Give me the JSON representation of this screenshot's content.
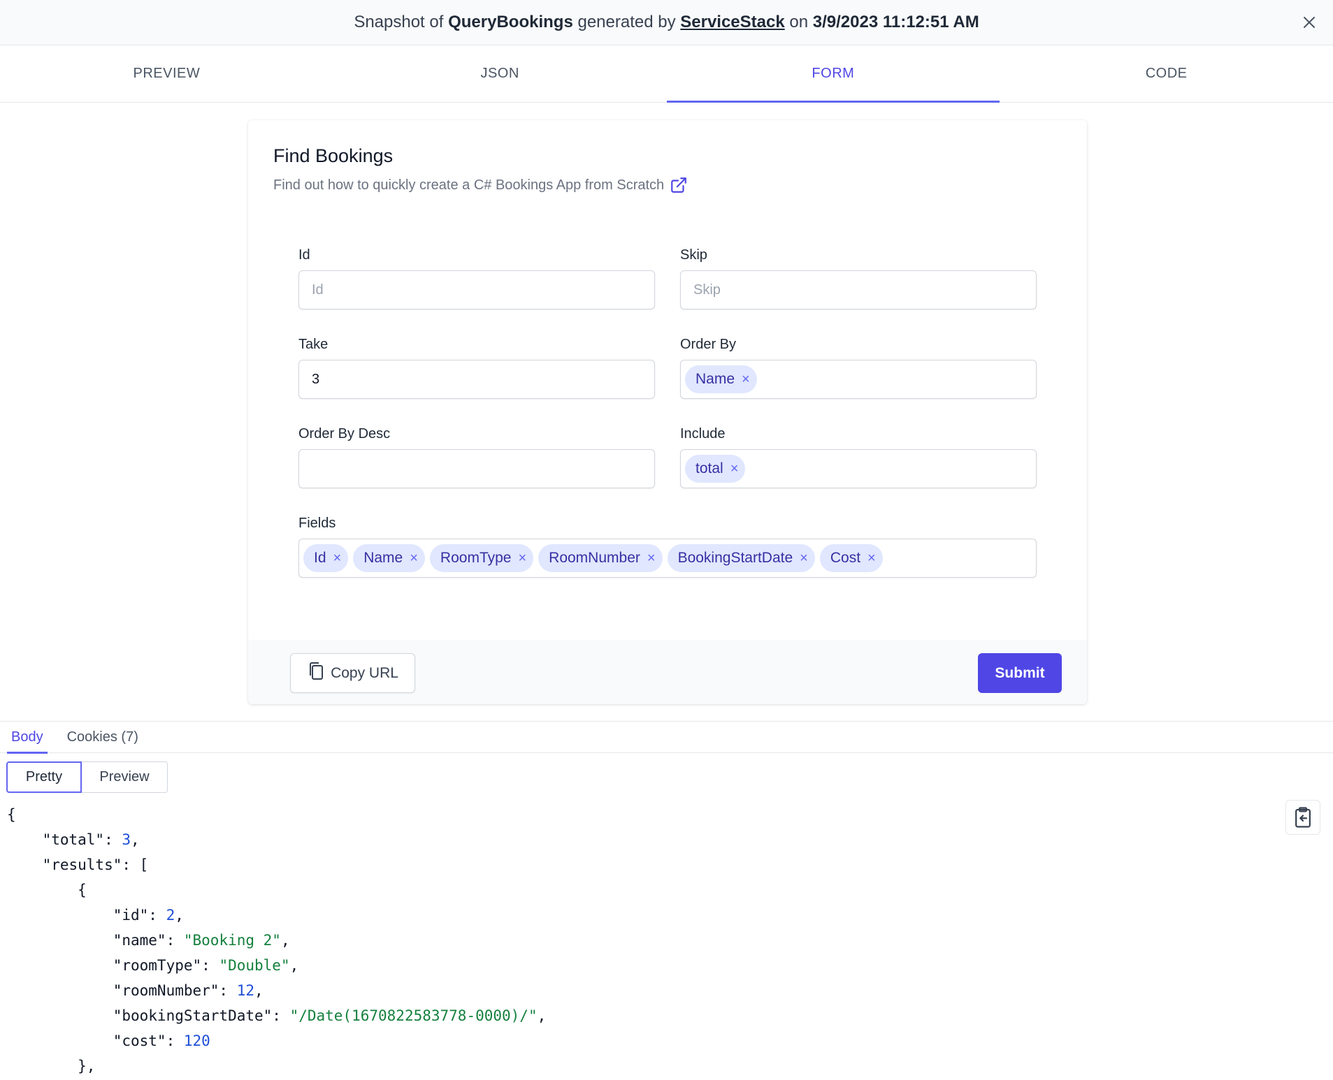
{
  "banner": {
    "prefix": "Snapshot of",
    "api_name": "QueryBookings",
    "middle": "generated by",
    "vendor": "ServiceStack",
    "on_text": "on",
    "timestamp": "3/9/2023 11:12:51 AM",
    "close_icon": "close-icon"
  },
  "tabs": [
    {
      "label": "PREVIEW",
      "active": false
    },
    {
      "label": "JSON",
      "active": false
    },
    {
      "label": "FORM",
      "active": true
    },
    {
      "label": "CODE",
      "active": false
    }
  ],
  "form": {
    "title": "Find Bookings",
    "subtitle": "Find out how to quickly create a C# Bookings App from Scratch",
    "subtitle_icon": "external-link-icon",
    "fields": {
      "id": {
        "label": "Id",
        "placeholder": "Id",
        "value": ""
      },
      "skip": {
        "label": "Skip",
        "placeholder": "Skip",
        "value": ""
      },
      "take": {
        "label": "Take",
        "value": "3"
      },
      "order_by": {
        "label": "Order By",
        "tags": [
          "Name"
        ]
      },
      "order_by_desc": {
        "label": "Order By Desc",
        "tags": []
      },
      "include": {
        "label": "Include",
        "tags": [
          "total"
        ]
      },
      "fields": {
        "label": "Fields",
        "tags": [
          "Id",
          "Name",
          "RoomType",
          "RoomNumber",
          "BookingStartDate",
          "Cost"
        ]
      }
    },
    "tag_remove_glyph": "×",
    "copy_url_label": "Copy URL",
    "copy_icon": "copy-icon",
    "submit_label": "Submit"
  },
  "response": {
    "tabs": [
      {
        "label": "Body",
        "active": true
      },
      {
        "label": "Cookies (7)",
        "active": false
      }
    ],
    "view_modes": [
      "Pretty",
      "Preview"
    ],
    "clipboard_icon": "clipboard-icon",
    "json_lines": [
      [
        {
          "t": "{"
        }
      ],
      [
        {
          "t": "    \"total\": "
        },
        {
          "t": "3",
          "c": "num"
        },
        {
          "t": ","
        }
      ],
      [
        {
          "t": "    \"results\": ["
        }
      ],
      [
        {
          "t": "        {"
        }
      ],
      [
        {
          "t": "            \"id\": "
        },
        {
          "t": "2",
          "c": "num"
        },
        {
          "t": ","
        }
      ],
      [
        {
          "t": "            \"name\": "
        },
        {
          "t": "\"Booking 2\"",
          "c": "str"
        },
        {
          "t": ","
        }
      ],
      [
        {
          "t": "            \"roomType\": "
        },
        {
          "t": "\"Double\"",
          "c": "str"
        },
        {
          "t": ","
        }
      ],
      [
        {
          "t": "            \"roomNumber\": "
        },
        {
          "t": "12",
          "c": "num"
        },
        {
          "t": ","
        }
      ],
      [
        {
          "t": "            \"bookingStartDate\": "
        },
        {
          "t": "\"/Date(1670822583778-0000)/\"",
          "c": "str"
        },
        {
          "t": ","
        }
      ],
      [
        {
          "t": "            \"cost\": "
        },
        {
          "t": "120",
          "c": "num"
        }
      ],
      [
        {
          "t": "        },"
        }
      ]
    ]
  },
  "colors": {
    "accent": "#4f46e5",
    "tag_bg": "#e0e7ff",
    "tag_text": "#3730a3",
    "json_number": "#1d4ed8",
    "json_string": "#15803d"
  }
}
